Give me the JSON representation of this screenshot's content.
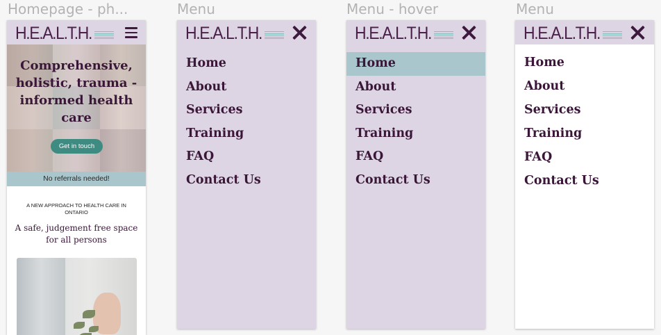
{
  "frames": [
    {
      "label": "Homepage - ph..."
    },
    {
      "label": "Menu"
    },
    {
      "label": "Menu - hover"
    },
    {
      "label": "Menu"
    }
  ],
  "logo": {
    "text": "H.E.A.L.T.H."
  },
  "hero": {
    "title": "Comprehensive, holistic, trauma - informed health care",
    "button_label": "Get in touch"
  },
  "banner": "No referrals needed!",
  "intro": {
    "kicker": "A NEW APPROACH TO HEALTH CARE IN ONTARIO",
    "subhead": "A safe, judgement free space for all persons"
  },
  "menu": {
    "items": [
      "Home",
      "About",
      "Services",
      "Training",
      "FAQ",
      "Contact Us"
    ],
    "hover_item": "Home"
  },
  "colors": {
    "brand_purple": "#3a1638",
    "header_lavender": "#ddd5e3",
    "accent_teal": "#3e8b82",
    "hover_blue": "#a9c6cd"
  },
  "icons": [
    "hamburger-menu-icon",
    "close-icon"
  ]
}
